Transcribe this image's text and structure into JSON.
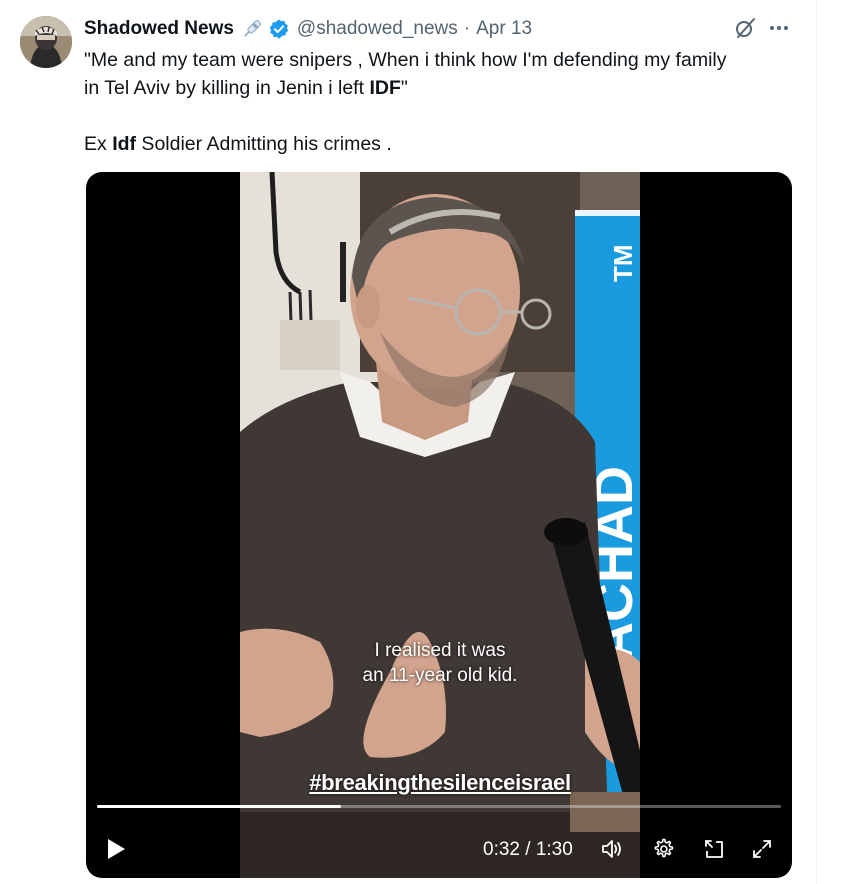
{
  "tweet": {
    "author_name": "Shadowed News",
    "author_handle": "@shadowed_news",
    "separator": "·",
    "date": "Apr 13",
    "text_line1": "\"Me and my team were snipers , When i think how I'm defending my family",
    "text_line2_prefix": "in Tel Aviv by killing in Jenin i left ",
    "text_line2_bold": "IDF",
    "text_line2_suffix": "\"",
    "text_line3_prefix": "Ex ",
    "text_line3_bold": "Idf",
    "text_line3_suffix": " Soldier Admitting his crimes ."
  },
  "video": {
    "subtitle_line1": "I realised it was",
    "subtitle_line2": "an 11-year old kid.",
    "hashtag_overlay": "#breakingthesilenceisrael",
    "banner_text": "YACHAD",
    "banner_mark": "TM",
    "current_time": "0:32",
    "time_separator": " / ",
    "duration": "1:30",
    "progress_fraction": 0.356
  },
  "icons": {
    "pin": "pin-icon",
    "verified": "verified-badge-icon",
    "grok": "grok-icon",
    "more": "more-icon",
    "play": "play-icon",
    "volume": "volume-icon",
    "settings": "gear-icon",
    "pip": "picture-in-picture-icon",
    "fullscreen": "fullscreen-icon"
  },
  "colors": {
    "verified": "#1d9bf0",
    "muted_text": "#536471",
    "banner_blue": "#1a9be0"
  }
}
